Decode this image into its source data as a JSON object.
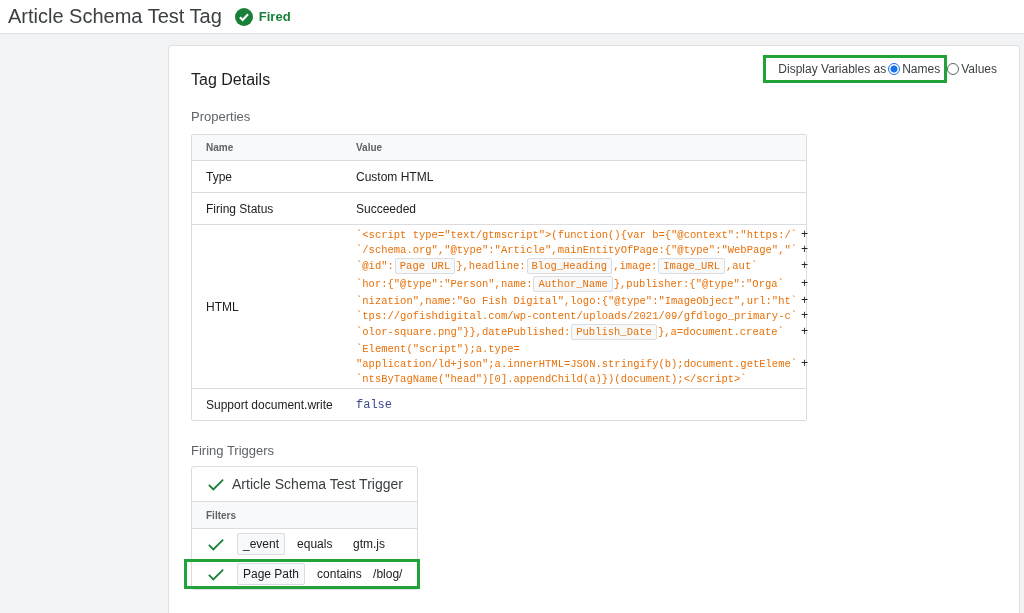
{
  "header": {
    "title": "Article Schema Test Tag",
    "status": "Fired",
    "fired": true
  },
  "details": {
    "title": "Tag Details",
    "display_toggle": {
      "label": "Display Variables as",
      "highlighted": true,
      "options": [
        {
          "label": "Names",
          "selected": true
        },
        {
          "label": "Values",
          "selected": false
        }
      ]
    }
  },
  "properties": {
    "title": "Properties",
    "columns": [
      "Name",
      "Value"
    ],
    "rows": [
      {
        "kind": "text",
        "name": "Type",
        "value": "Custom HTML"
      },
      {
        "kind": "text",
        "name": "Firing Status",
        "value": "Succeeded"
      },
      {
        "kind": "code",
        "name": "HTML",
        "lines": [
          {
            "parts": [
              {
                "kind": "code",
                "text": "`<script type=\"text/gtmscript\">(function(){var b={\"@context\":\"https:/`"
              }
            ],
            "plus": "+"
          },
          {
            "parts": [
              {
                "kind": "code",
                "text": "`/schema.org\",\"@type\":\"Article\",mainEntityOfPage:{\"@type\":\"WebPage\",\"`"
              }
            ],
            "plus": "+"
          },
          {
            "parts": [
              {
                "kind": "code",
                "text": "`@id\":"
              },
              {
                "kind": "var",
                "text": "Page URL"
              },
              {
                "kind": "code",
                "text": "},headline:"
              },
              {
                "kind": "var",
                "text": "Blog_Heading"
              },
              {
                "kind": "code",
                "text": ",image:"
              },
              {
                "kind": "var",
                "text": "Image_URL"
              },
              {
                "kind": "code",
                "text": ",aut`"
              }
            ],
            "plus": "+"
          },
          {
            "parts": [
              {
                "kind": "code",
                "text": "`hor:{\"@type\":\"Person\",name:"
              },
              {
                "kind": "var",
                "text": "Author_Name"
              },
              {
                "kind": "code",
                "text": "},publisher:{\"@type\":\"Orga`"
              }
            ],
            "plus": "+"
          },
          {
            "parts": [
              {
                "kind": "code",
                "text": "`nization\",name:\"Go Fish Digital\",logo:{\"@type\":\"ImageObject\",url:\"ht`"
              }
            ],
            "plus": "+"
          },
          {
            "parts": [
              {
                "kind": "code",
                "text": "`tps://gofishdigital.com/wp-content/uploads/2021/09/gfdlogo_primary-c`"
              }
            ],
            "plus": "+"
          },
          {
            "parts": [
              {
                "kind": "code",
                "text": "`olor-square.png\"}},datePublished:"
              },
              {
                "kind": "var",
                "text": "Publish_Date"
              },
              {
                "kind": "code",
                "text": "},a=document.create`"
              }
            ],
            "plus": "+"
          },
          {
            "parts": [
              {
                "kind": "code",
                "text": "`Element(\"script\");a.type="
              }
            ]
          },
          {
            "parts": [
              {
                "kind": "code",
                "text": "\"application/ld+json\";a.innerHTML=JSON.stringify(b);document.getEleme`"
              }
            ],
            "plus": "+"
          },
          {
            "parts": [
              {
                "kind": "code",
                "text": "`ntsByTagName(\"head\")[0].appendChild(a)})(document);</script>`"
              }
            ]
          }
        ]
      },
      {
        "kind": "bool",
        "name": "Support document.write",
        "value": "false"
      }
    ]
  },
  "triggers": {
    "title": "Firing Triggers",
    "trigger": {
      "name": "Article Schema Test Trigger",
      "passed": true
    },
    "filters_label": "Filters",
    "filters": [
      {
        "passed": true,
        "variable": "_event",
        "operator": "equals",
        "value": "gtm.js",
        "highlighted": false
      },
      {
        "passed": true,
        "variable": "Page Path",
        "operator": "contains",
        "value": "/blog/",
        "highlighted": true
      }
    ]
  }
}
